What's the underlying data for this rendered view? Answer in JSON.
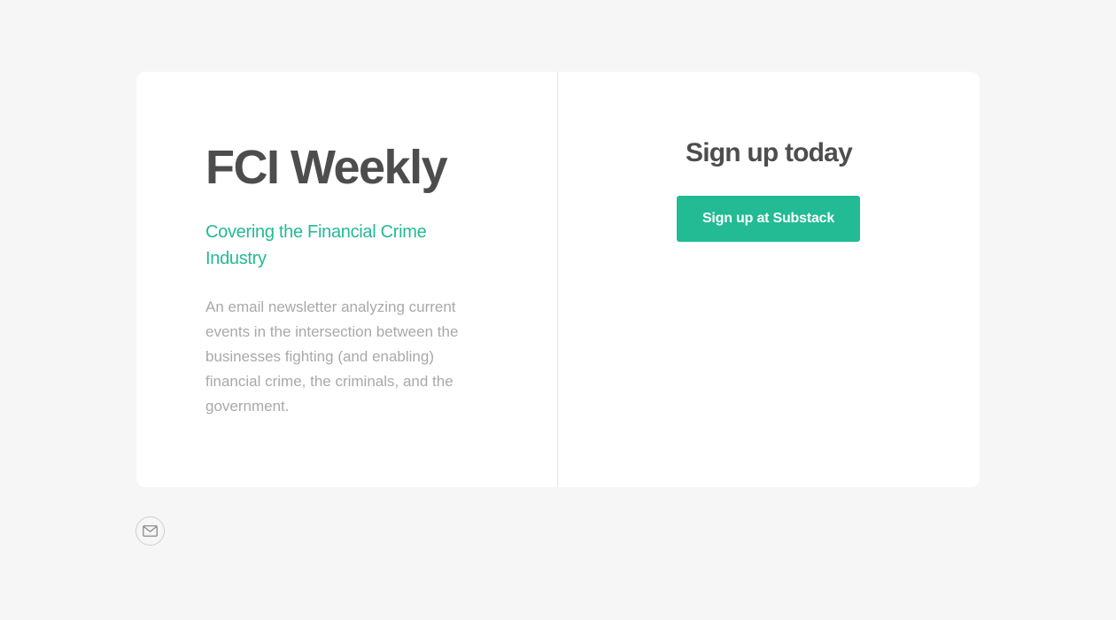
{
  "hero": {
    "title": "FCI Weekly",
    "subtitle": "Covering the Financial Crime Industry",
    "description": "An email newsletter analyzing current events in the intersection between the businesses fighting (and enabling) financial crime, the criminals, and the government."
  },
  "signup": {
    "heading": "Sign up today",
    "button_label": "Sign up at Substack"
  },
  "footer": {
    "email_icon": "envelope-icon"
  },
  "colors": {
    "accent": "#22bb93",
    "heading": "#4d4d4d",
    "body_text": "#a9a9a9",
    "background": "#f6f6f6",
    "card": "#ffffff"
  }
}
